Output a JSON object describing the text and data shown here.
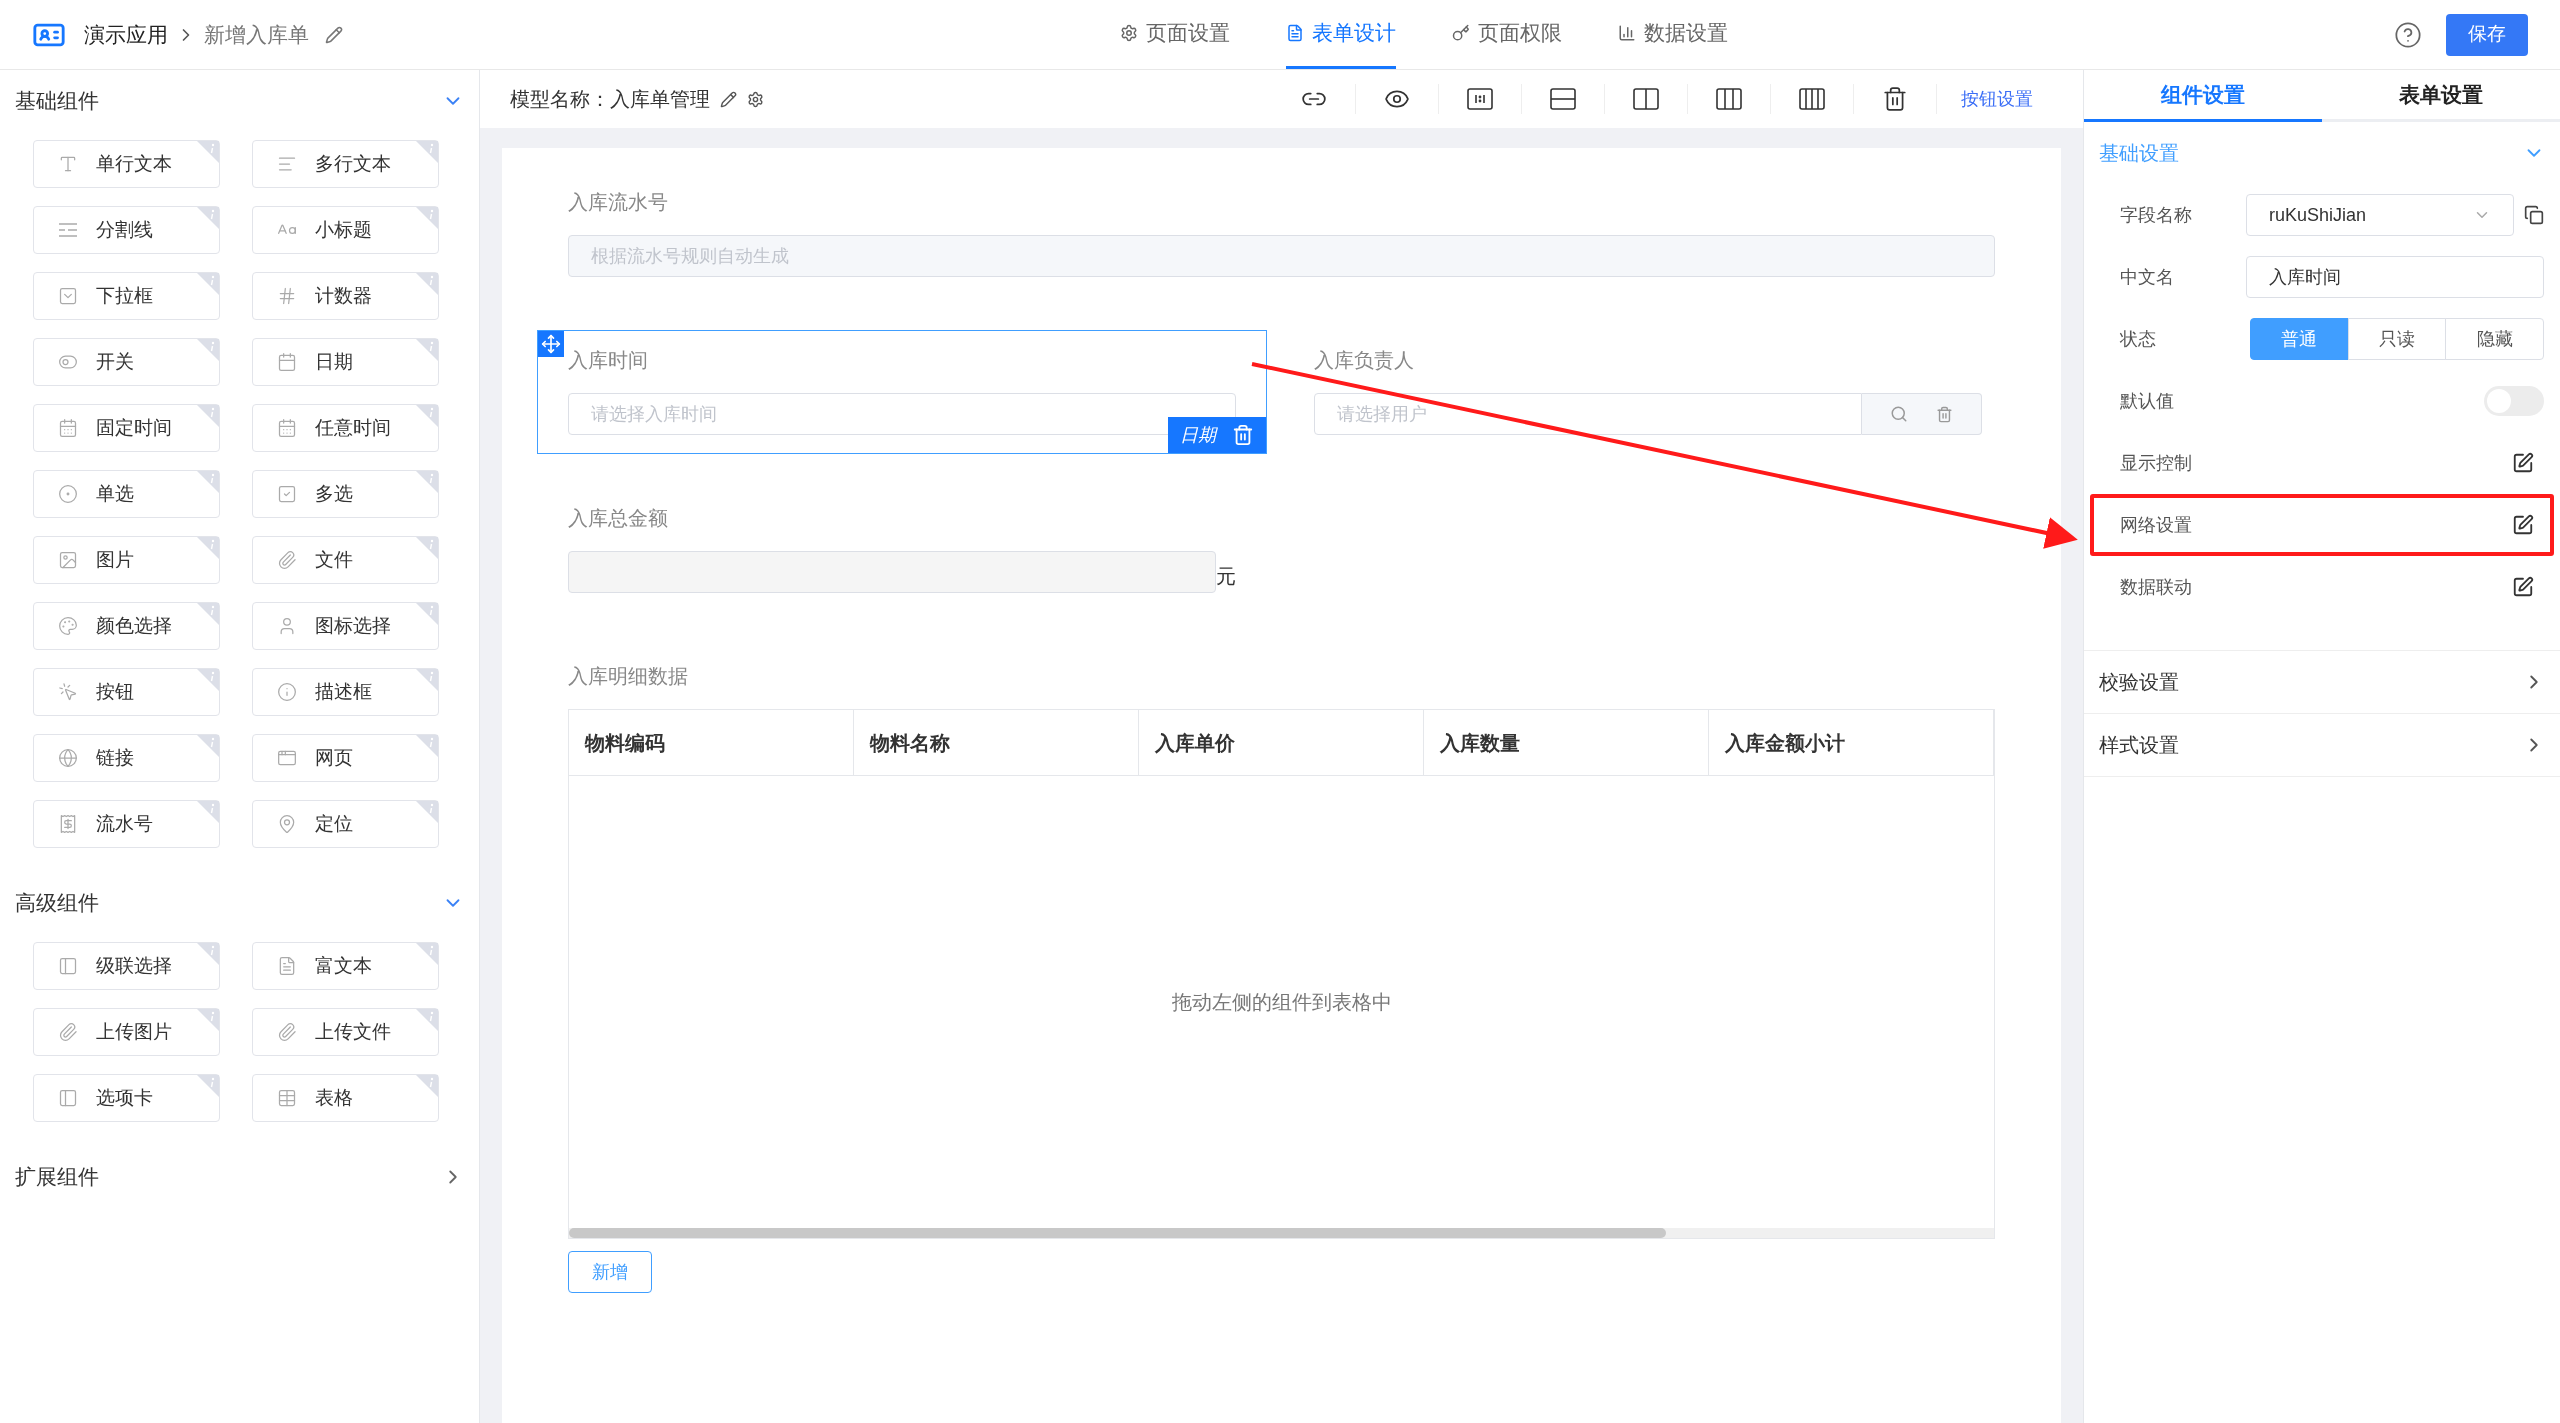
{
  "header": {
    "app": "演示应用",
    "page": "新增入库单",
    "save": "保存",
    "tabs": [
      {
        "label": "页面设置",
        "selected": false
      },
      {
        "label": "表单设计",
        "selected": true
      },
      {
        "label": "页面权限",
        "selected": false
      },
      {
        "label": "数据设置",
        "selected": false
      }
    ]
  },
  "palette": [
    {
      "title": "基础组件",
      "expanded": true,
      "items": [
        "单行文本",
        "多行文本",
        "分割线",
        "小标题",
        "下拉框",
        "计数器",
        "开关",
        "日期",
        "固定时间",
        "任意时间",
        "单选",
        "多选",
        "图片",
        "文件",
        "颜色选择",
        "图标选择",
        "按钮",
        "描述框",
        "链接",
        "网页",
        "流水号",
        "定位"
      ]
    },
    {
      "title": "高级组件",
      "expanded": true,
      "items": [
        "级联选择",
        "富文本",
        "上传图片",
        "上传文件",
        "选项卡",
        "表格"
      ]
    },
    {
      "title": "扩展组件",
      "expanded": false
    }
  ],
  "canvas": {
    "model_label": "模型名称：",
    "model_name": "入库单管理",
    "button_settings": "按钮设置",
    "rows": [
      [
        {
          "kind": "serial",
          "label": "入库流水号",
          "placeholder": "根据流水号规则自动生成",
          "selected": false
        }
      ],
      [
        {
          "kind": "date",
          "label": "入库时间",
          "placeholder": "请选择入库时间",
          "selected": true,
          "tag": "日期"
        },
        {
          "kind": "user",
          "label": "入库负责人",
          "placeholder": "请选择用户",
          "selected": false
        }
      ],
      [
        {
          "kind": "amount",
          "label": "入库总金额",
          "suffix": "元",
          "selected": false
        }
      ],
      [
        {
          "kind": "table",
          "label": "入库明细数据",
          "selected": false,
          "columns": [
            "物料编码",
            "物料名称",
            "入库单价",
            "入库数量",
            "入库金额小计"
          ],
          "empty_text": "拖动左侧的组件到表格中",
          "add_button": "新增"
        }
      ]
    ]
  },
  "settings": {
    "tabs": [
      {
        "label": "组件设置",
        "selected": true
      },
      {
        "label": "表单设置",
        "selected": false
      }
    ],
    "sections": [
      {
        "title": "基础设置",
        "expanded": true,
        "rows": [
          {
            "kind": "select",
            "label": "字段名称",
            "value": "ruKuShiJian"
          },
          {
            "kind": "input",
            "label": "中文名",
            "value": "入库时间"
          },
          {
            "kind": "segmented",
            "label": "状态",
            "options": [
              {
                "label": "普通",
                "selected": true
              },
              {
                "label": "只读",
                "selected": false
              },
              {
                "label": "隐藏",
                "selected": false
              }
            ]
          },
          {
            "kind": "switch",
            "label": "默认值",
            "on": false
          },
          {
            "kind": "edit",
            "label": "显示控制",
            "highlighted": false
          },
          {
            "kind": "edit",
            "label": "网络设置",
            "highlighted": true
          },
          {
            "kind": "edit",
            "label": "数据联动",
            "highlighted": false
          }
        ]
      },
      {
        "title": "校验设置",
        "expanded": false
      },
      {
        "title": "样式设置",
        "expanded": false
      }
    ]
  }
}
